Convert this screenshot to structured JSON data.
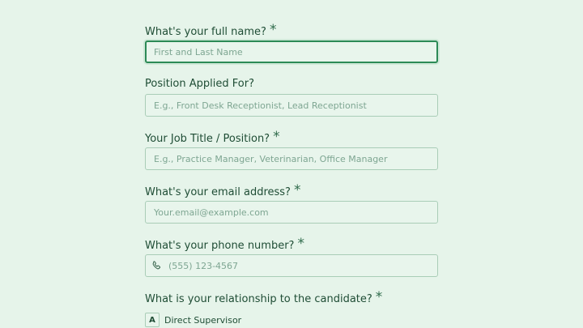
{
  "form": {
    "required_marker": "*",
    "full_name": {
      "label": "What's your full name?",
      "placeholder": "First and Last Name",
      "value": ""
    },
    "position_applied": {
      "label": "Position Applied For?",
      "placeholder": "E.g., Front Desk Receptionist, Lead Receptionist",
      "value": ""
    },
    "job_title": {
      "label": "Your Job Title / Position?",
      "placeholder": "E.g., Practice Manager, Veterinarian, Office Manager",
      "value": ""
    },
    "email": {
      "label": "What's your email address?",
      "placeholder": "Your.email@example.com",
      "value": ""
    },
    "phone": {
      "label": "What's your phone number?",
      "placeholder": "(555) 123-4567",
      "value": "",
      "icon": "phone-icon"
    },
    "relationship": {
      "label": "What is your relationship to the candidate?",
      "options": [
        {
          "key": "A",
          "label": "Direct Supervisor"
        }
      ]
    }
  },
  "colors": {
    "background": "#e6f4ea",
    "text": "#1f4d35",
    "border": "#a9cdb7",
    "focus_border": "#2c8a56"
  }
}
